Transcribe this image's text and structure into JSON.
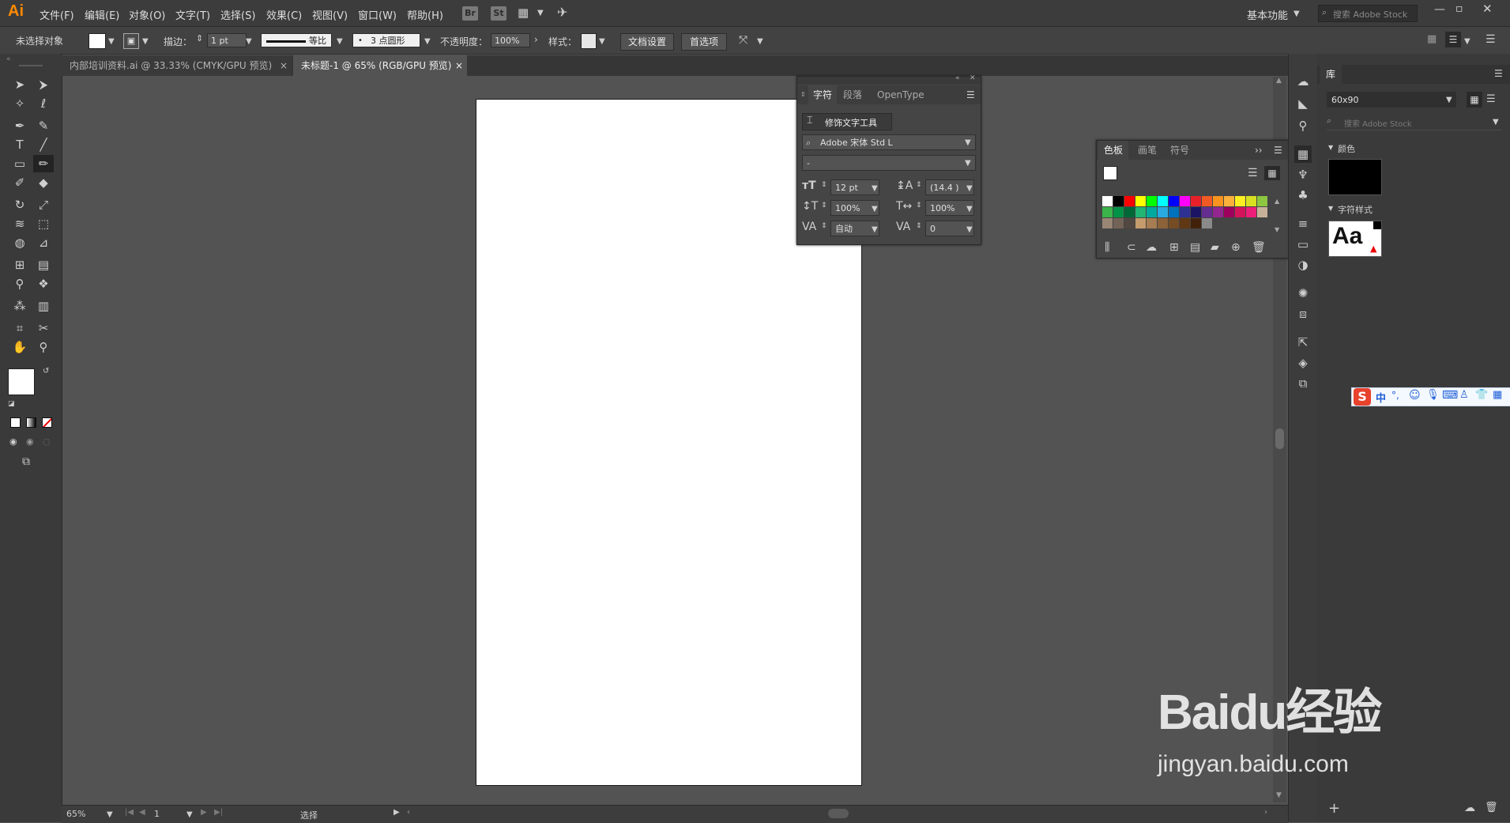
{
  "app": {
    "logo": "Ai"
  },
  "menu": {
    "items": [
      "文件(F)",
      "编辑(E)",
      "对象(O)",
      "文字(T)",
      "选择(S)",
      "效果(C)",
      "视图(V)",
      "窗口(W)",
      "帮助(H)"
    ],
    "bridge": "Br",
    "stock": "St"
  },
  "header_right": {
    "workspace": "基本功能",
    "search_placeholder": "搜索 Adobe Stock"
  },
  "control": {
    "selection_status": "未选择对象",
    "stroke_label": "描边：",
    "stroke_value": "1 pt",
    "profile_label": "等比",
    "brush_label": "3 点圆形",
    "opacity_label": "不透明度：",
    "opacity_value": "100%",
    "style_label": "样式：",
    "doc_setup": "文档设置",
    "preferences": "首选项"
  },
  "tabs": [
    {
      "label": "内部培训资料.ai @ 33.33% (CMYK/GPU 预览)",
      "close": "×"
    },
    {
      "label": "未标题-1 @ 65% (RGB/GPU 预览)",
      "close": "×"
    }
  ],
  "status": {
    "zoom": "65%",
    "page": "1",
    "tool": "选择"
  },
  "character_panel": {
    "tabs": [
      "字符",
      "段落",
      "OpenType"
    ],
    "touch_type": "修饰文字工具",
    "font_family": "Adobe 宋体 Std L",
    "font_style": "-",
    "font_size": "12 pt",
    "leading": "(14.4 )",
    "vertical_scale": "100%",
    "horizontal_scale": "100%",
    "kerning": "自动",
    "tracking": "0"
  },
  "swatches_panel": {
    "tabs": [
      "色板",
      "画笔",
      "符号"
    ],
    "colors": [
      "#ffffff",
      "#000000",
      "#ff0000",
      "#ffff00",
      "#00ff00",
      "#00ffff",
      "#0000ff",
      "#ff00ff",
      "#e8202a",
      "#f15a24",
      "#f7931e",
      "#fbb03b",
      "#fcee21",
      "#d9e021",
      "#8cc63f",
      "#39b54a",
      "#009245",
      "#006837",
      "#22b573",
      "#00a99d",
      "#29abe2",
      "#0071bc",
      "#2e3192",
      "#1b1464",
      "#662d91",
      "#93278f",
      "#9e005d",
      "#d4145a",
      "#ed1e79",
      "#c7b299",
      "#998675",
      "#736357",
      "#534741",
      "#c69c6d",
      "#a67c52",
      "#8c6239",
      "#754c24",
      "#603813",
      "#42210b",
      "#8a8a8a"
    ]
  },
  "library": {
    "title": "库",
    "preset": "60x90",
    "search_placeholder": "搜索 Adobe Stock",
    "colors_label": "颜色",
    "char_styles_label": "字符样式",
    "sample_text": "Aa"
  },
  "ime_toolbar": {
    "mode": "中"
  },
  "watermark": {
    "brand": "Baidu经验",
    "url": "jingyan.baidu.com"
  }
}
